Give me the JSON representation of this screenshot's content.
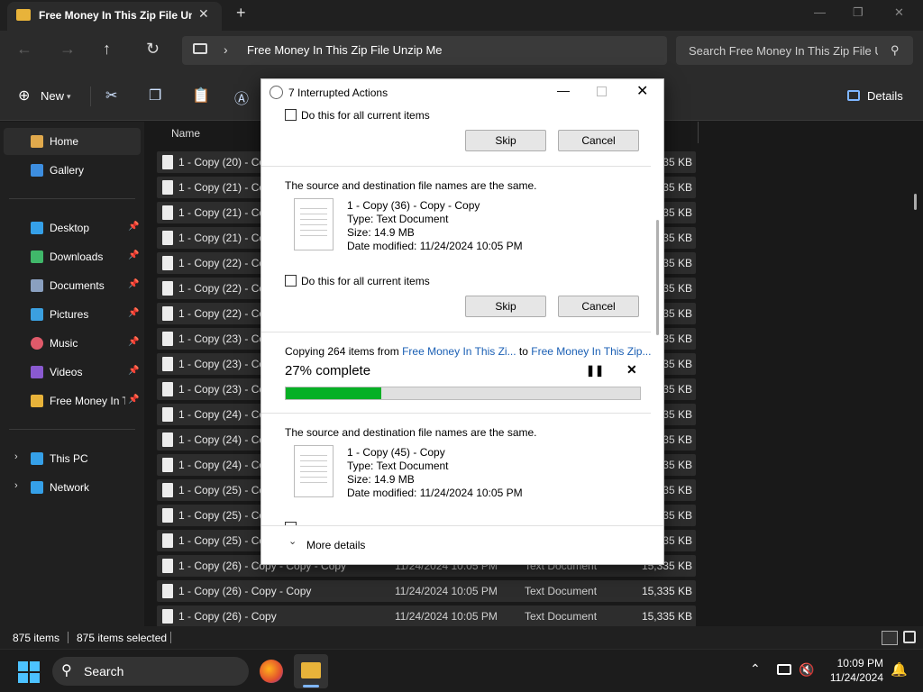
{
  "window": {
    "tab_title": "Free Money In This Zip File Un",
    "tab_close": "✕",
    "new_tab": "+",
    "minimize": "—",
    "maximize": "❐",
    "close": "✕"
  },
  "nav": {
    "address": "Free Money In This Zip File Unzip Me",
    "search_placeholder": "Search Free Money In This Zip File Unzip Me"
  },
  "toolbar": {
    "new_label": "New",
    "details_label": "Details"
  },
  "sidebar": {
    "items": [
      {
        "label": "Home",
        "icon": "home-icon",
        "color": "#e0a94c"
      },
      {
        "label": "Gallery",
        "icon": "gallery-icon",
        "color": "#3d8ee0"
      },
      {
        "label": "Desktop",
        "icon": "desktop-icon",
        "color": "#35a0e8"
      },
      {
        "label": "Downloads",
        "icon": "download-icon",
        "color": "#40b86a"
      },
      {
        "label": "Documents",
        "icon": "documents-icon",
        "color": "#8aa0c0"
      },
      {
        "label": "Pictures",
        "icon": "pictures-icon",
        "color": "#3ba0e0"
      },
      {
        "label": "Music",
        "icon": "music-icon",
        "color": "#e05a6a"
      },
      {
        "label": "Videos",
        "icon": "videos-icon",
        "color": "#8a5ad0"
      },
      {
        "label": "Free Money In T",
        "icon": "folder-icon",
        "color": "#e8b33a"
      },
      {
        "label": "This PC",
        "icon": "pc-icon",
        "color": "#35a0e8"
      },
      {
        "label": "Network",
        "icon": "network-icon",
        "color": "#35a0e8"
      }
    ]
  },
  "filelist": {
    "header_name": "Name",
    "rows_hidden": [
      {
        "name": "1 - Copy (20) - Co",
        "size": "15,335 KB"
      },
      {
        "name": "1 - Copy (21) - Co",
        "size": "15,335 KB"
      },
      {
        "name": "1 - Copy (21) - Co",
        "size": "15,335 KB"
      },
      {
        "name": "1 - Copy (21) - Co",
        "size": "15,335 KB"
      },
      {
        "name": "1 - Copy (22) - Co",
        "size": "15,335 KB"
      },
      {
        "name": "1 - Copy (22) - Co",
        "size": "15,335 KB"
      },
      {
        "name": "1 - Copy (22) - Co",
        "size": "15,335 KB"
      },
      {
        "name": "1 - Copy (23) - Co",
        "size": "15,335 KB"
      },
      {
        "name": "1 - Copy (23) - Co",
        "size": "15,335 KB"
      },
      {
        "name": "1 - Copy (23) - Co",
        "size": "15,335 KB"
      },
      {
        "name": "1 - Copy (24) - Co",
        "size": "15,335 KB"
      },
      {
        "name": "1 - Copy (24) - Co",
        "size": "15,335 KB"
      },
      {
        "name": "1 - Copy (24) - Co",
        "size": "15,335 KB"
      },
      {
        "name": "1 - Copy (25) - Co",
        "size": "15,335 KB"
      },
      {
        "name": "1 - Copy (25) - Co",
        "size": "15,335 KB"
      },
      {
        "name": "1 - Copy (25) - Co",
        "size": "15,335 KB"
      },
      {
        "name": "1 - Copy (26) - Copy - Copy - Copy",
        "size": "15,335 KB"
      }
    ],
    "rows_full": [
      {
        "name": "1 - Copy (26) - Copy - Copy",
        "date": "11/24/2024 10:05 PM",
        "type": "Text Document",
        "size": "15,335 KB"
      },
      {
        "name": "1 - Copy (26) - Copy",
        "date": "11/24/2024 10:05 PM",
        "type": "Text Document",
        "size": "15,335 KB"
      }
    ],
    "partial_date": "11/24/2024 10:05 PM",
    "partial_type": "Text Document"
  },
  "status": {
    "items": "875 items",
    "selected": "875 items selected"
  },
  "taskbar": {
    "search": "Search",
    "time": "10:09 PM",
    "date": "11/24/2024"
  },
  "dialog": {
    "title": "7 Interrupted Actions",
    "do_for_all": "Do this for all current items",
    "skip": "Skip",
    "cancel": "Cancel",
    "conflict_msg": "The source and destination file names are the same.",
    "file1": {
      "name": "1 - Copy (36) - Copy - Copy",
      "type": "Type: Text Document",
      "size": "Size: 14.9 MB",
      "date": "Date modified: 11/24/2024 10:05 PM"
    },
    "file2": {
      "name": "1 - Copy (45) - Copy",
      "type": "Type: Text Document",
      "size": "Size: 14.9 MB",
      "date": "Date modified: 11/24/2024 10:05 PM"
    },
    "copy_prefix": "Copying 264 items from",
    "copy_from": "Free Money In This Zi...",
    "copy_to_word": "to",
    "copy_to": "Free Money In This Zip...",
    "percent_text": "27% complete",
    "progress": 0.27,
    "more_details": "More details"
  }
}
